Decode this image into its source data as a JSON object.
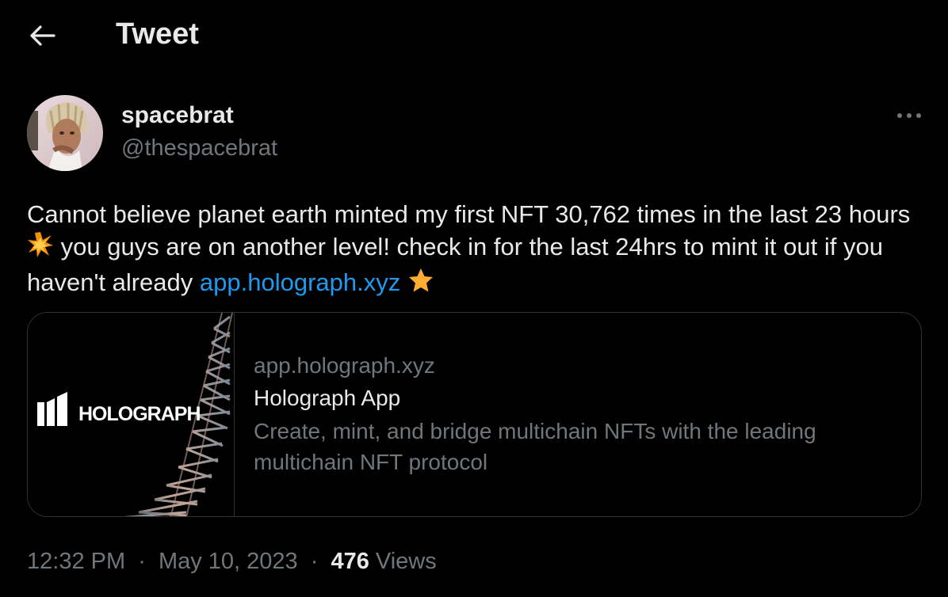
{
  "header": {
    "title": "Tweet",
    "back_icon": "arrow-left-icon"
  },
  "author": {
    "display_name": "spacebrat",
    "handle": "@thespacebrat",
    "more_icon": "more-horizontal-icon"
  },
  "tweet": {
    "text_part1": "Cannot believe planet earth minted my first NFT 30,762 times in the last 23 hours",
    "emoji1": "collision-emoji",
    "text_part2": " you guys are on another level! check in for the last 24hrs to mint it out if you haven't already ",
    "link": "app.holograph.xyz",
    "emoji2": "star-emoji"
  },
  "card": {
    "logo_text": "HOLOGRAPH",
    "domain": "app.holograph.xyz",
    "title": "Holograph App",
    "description": "Create, mint, and bridge multichain NFTs with the leading multichain NFT protocol"
  },
  "meta": {
    "time": "12:32 PM",
    "date": "May 10, 2023",
    "views_count": "476",
    "views_label": "Views",
    "separator": "·"
  },
  "colors": {
    "background": "#000000",
    "text": "#e7e9ea",
    "secondary": "#71767b",
    "link": "#1d9bf0",
    "border": "#2f3336"
  }
}
